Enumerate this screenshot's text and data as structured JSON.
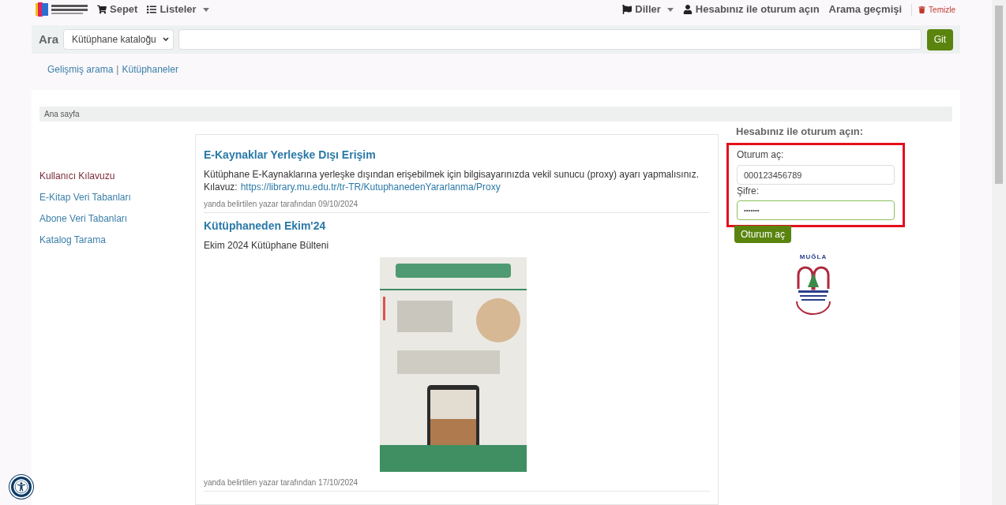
{
  "header": {
    "nav": [
      {
        "kind": "cart",
        "label": "Sepet",
        "dropdown": false
      },
      {
        "kind": "lists",
        "label": "Listeler",
        "dropdown": true
      }
    ],
    "right": [
      {
        "kind": "flag",
        "label": "Diller",
        "dropdown": true
      },
      {
        "kind": "user",
        "label": "Hesabınız ile oturum açın",
        "dropdown": false
      },
      {
        "kind": "plain",
        "label": "Arama geçmişi",
        "dropdown": false
      }
    ],
    "clear": "Temizle"
  },
  "search": {
    "label": "Ara",
    "scope": "Kütüphane kataloğu",
    "button": "Git"
  },
  "links": [
    "Gelişmiş arama",
    "Kütüphaneler"
  ],
  "links_separator": "|",
  "breadcrumb": "Ana sayfa",
  "sidebar": [
    {
      "label": "Kullanıcı Kılavuzu",
      "visited": true
    },
    {
      "label": "E-Kitap Veri Tabanları",
      "visited": false
    },
    {
      "label": "Abone Veri Tabanları",
      "visited": false
    },
    {
      "label": "Katalog Tarama",
      "visited": false
    }
  ],
  "news": [
    {
      "title": "E-Kaynaklar Yerleşke Dışı Erişim",
      "text": "Kütüphane E-Kaynaklarına yerleşke dışından erişebilmek için bilgisayarınızda vekil sunucu (proxy) ayarı yapmalısınız.",
      "link_label": "Kılavuz:",
      "link": "https://library.mu.edu.tr/tr-TR/KutuphanedenYararlanma/Proxy",
      "meta": "yanda belirtilen yazar tarafından 09/10/2024"
    },
    {
      "title": "Kütüphaneden Ekim'24",
      "text": "Ekim 2024 Kütüphane Bülteni",
      "meta": "yanda belirtilen yazar tarafından 17/10/2024"
    }
  ],
  "login": {
    "heading": "Hesabınız ile oturum açın:",
    "user_label": "Oturum aç:",
    "user_value": "000123456789",
    "password_label": "Şifre:",
    "password_value": "•••••••",
    "password_focused": true,
    "highlighted": true,
    "button": "Oturum aç",
    "logo_text": "MUĞLA"
  }
}
